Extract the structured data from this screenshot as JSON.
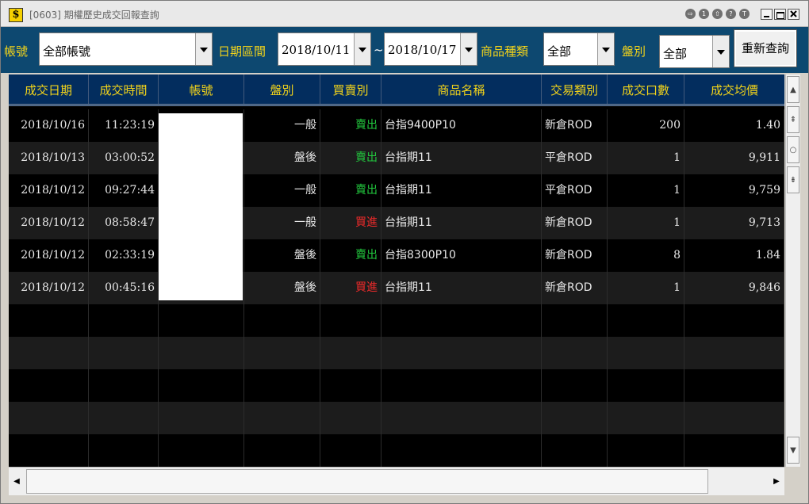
{
  "window": {
    "title": "[0603] 期權歷史成交回報查詢",
    "app_icon_glyph": "$",
    "title_buttons": [
      "⇨",
      "1",
      "⇧",
      "?",
      "T"
    ]
  },
  "filters": {
    "account_label": "帳號",
    "account_value": "全部帳號",
    "date_range_label": "日期區間",
    "date_from": "2018/10/11",
    "date_sep": "~",
    "date_to": "2018/10/17",
    "product_type_label": "商品種類",
    "product_type_value": "全部",
    "session_label": "盤別",
    "session_value": "全部",
    "requery_label": "重新查詢"
  },
  "table": {
    "headers": [
      "成交日期",
      "成交時間",
      "帳號",
      "盤別",
      "買賣別",
      "商品名稱",
      "交易類別",
      "成交口數",
      "成交均價"
    ],
    "rows": [
      {
        "date": "2018/10/16",
        "time": "11:23:19",
        "account": "",
        "session": "一般",
        "side": "賣出",
        "side_type": "sell",
        "product": "台指9400P10",
        "trade_type": "新倉ROD",
        "qty": "200",
        "price": "1.40"
      },
      {
        "date": "2018/10/13",
        "time": "03:00:52",
        "account": "",
        "session": "盤後",
        "side": "賣出",
        "side_type": "sell",
        "product": "台指期11",
        "trade_type": "平倉ROD",
        "qty": "1",
        "price": "9,911"
      },
      {
        "date": "2018/10/12",
        "time": "09:27:44",
        "account": "",
        "session": "一般",
        "side": "賣出",
        "side_type": "sell",
        "product": "台指期11",
        "trade_type": "平倉ROD",
        "qty": "1",
        "price": "9,759"
      },
      {
        "date": "2018/10/12",
        "time": "08:58:47",
        "account": "",
        "session": "一般",
        "side": "買進",
        "side_type": "buy",
        "product": "台指期11",
        "trade_type": "新倉ROD",
        "qty": "1",
        "price": "9,713"
      },
      {
        "date": "2018/10/12",
        "time": "02:33:19",
        "account": "",
        "session": "盤後",
        "side": "賣出",
        "side_type": "sell",
        "product": "台指8300P10",
        "trade_type": "新倉ROD",
        "qty": "8",
        "price": "1.84"
      },
      {
        "date": "2018/10/12",
        "time": "00:45:16",
        "account": "",
        "session": "盤後",
        "side": "買進",
        "side_type": "buy",
        "product": "台指期11",
        "trade_type": "新倉ROD",
        "qty": "1",
        "price": "9,846"
      }
    ]
  },
  "colors": {
    "toolbar_bg": "#0d4870",
    "header_bg": "#032d5e",
    "label_yellow": "#f2d31a",
    "sell_green": "#22c93e",
    "buy_red": "#ee2a2a"
  }
}
